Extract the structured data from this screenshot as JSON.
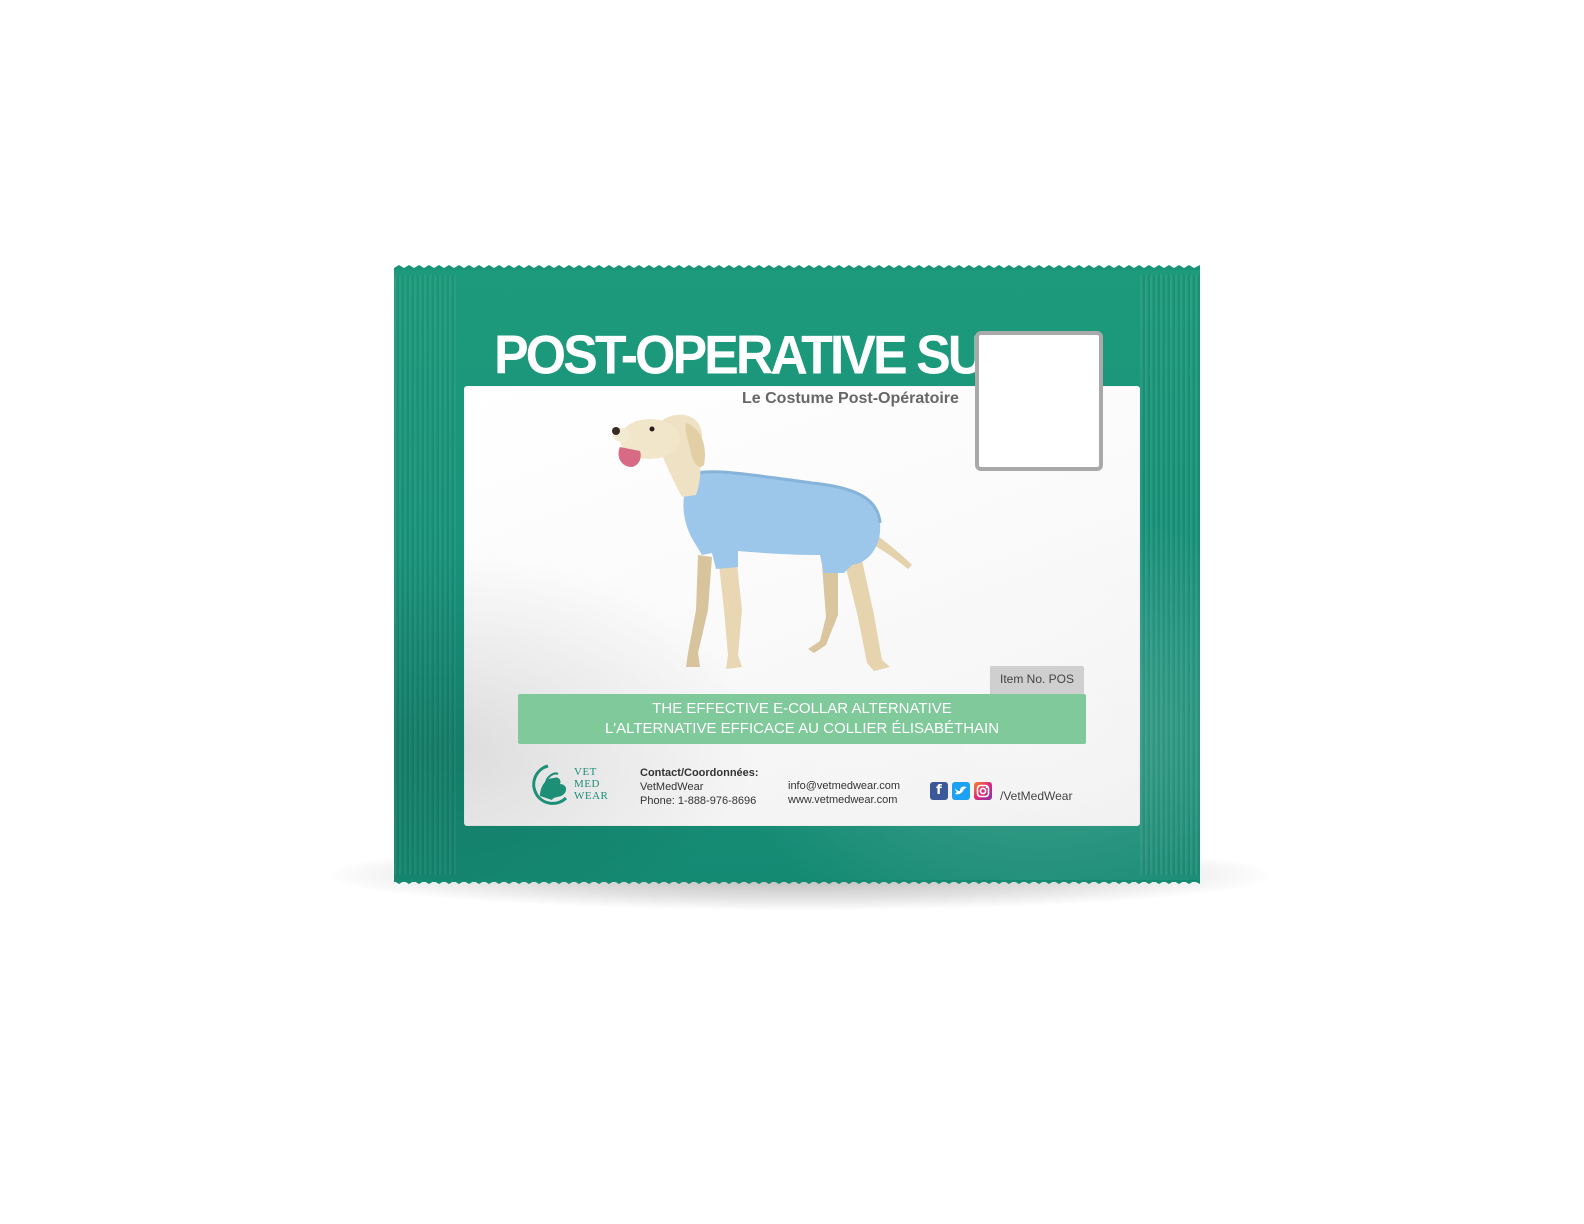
{
  "product": {
    "title": "POST-OPERATIVE SUIT",
    "subtitle": "Le Costume Post-Opératoire",
    "item_no": "Item No. POS"
  },
  "banner": {
    "line_en": "THE EFFECTIVE E-COLLAR ALTERNATIVE",
    "line_fr": "L'ALTERNATIVE EFFICACE AU COLLIER ÉLISABÉTHAIN"
  },
  "brand": {
    "logo_line1": "VET",
    "logo_line2": "MED",
    "logo_line3": "WEAR"
  },
  "contact": {
    "heading": "Contact/Coordonnées:",
    "company": "VetMedWear",
    "phone": "Phone: 1-888-976-8696",
    "email": "info@vetmedwear.com",
    "website": "www.vetmedwear.com"
  },
  "social": {
    "icons": [
      "facebook-icon",
      "twitter-icon",
      "instagram-icon"
    ],
    "handle": "/VetMedWear"
  },
  "colors": {
    "pouch_green": "#1a9478",
    "banner_green": "#7fc99a",
    "suit_blue": "#9cc6ea",
    "label_white": "#ffffff"
  }
}
